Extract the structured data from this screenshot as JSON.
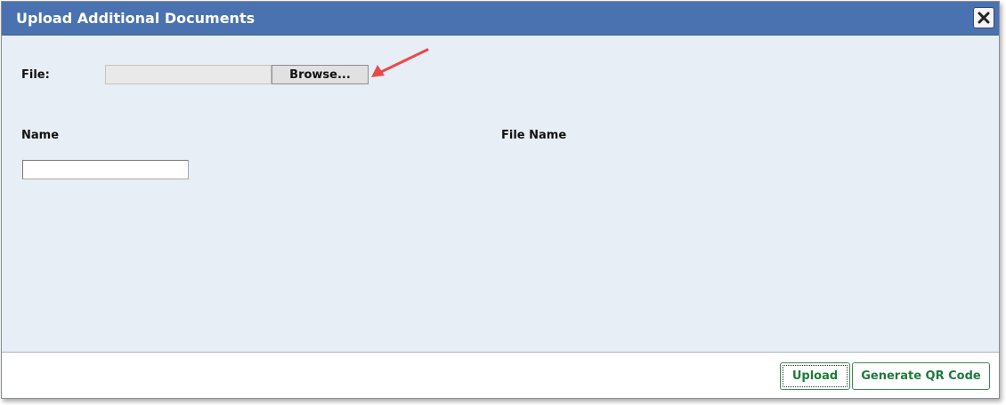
{
  "dialog": {
    "title": "Upload Additional Documents",
    "close_icon": "close-icon"
  },
  "form": {
    "file_label": "File:",
    "file_path_value": "",
    "browse_label": "Browse...",
    "name_header": "Name",
    "file_name_header": "File Name",
    "name_value": ""
  },
  "footer": {
    "upload_label": "Upload",
    "qr_label": "Generate QR Code"
  },
  "colors": {
    "titlebar": "#4a72b0",
    "body": "#e8eef6",
    "button_text": "#1f7a3a",
    "arrow": "#e84a4a"
  }
}
